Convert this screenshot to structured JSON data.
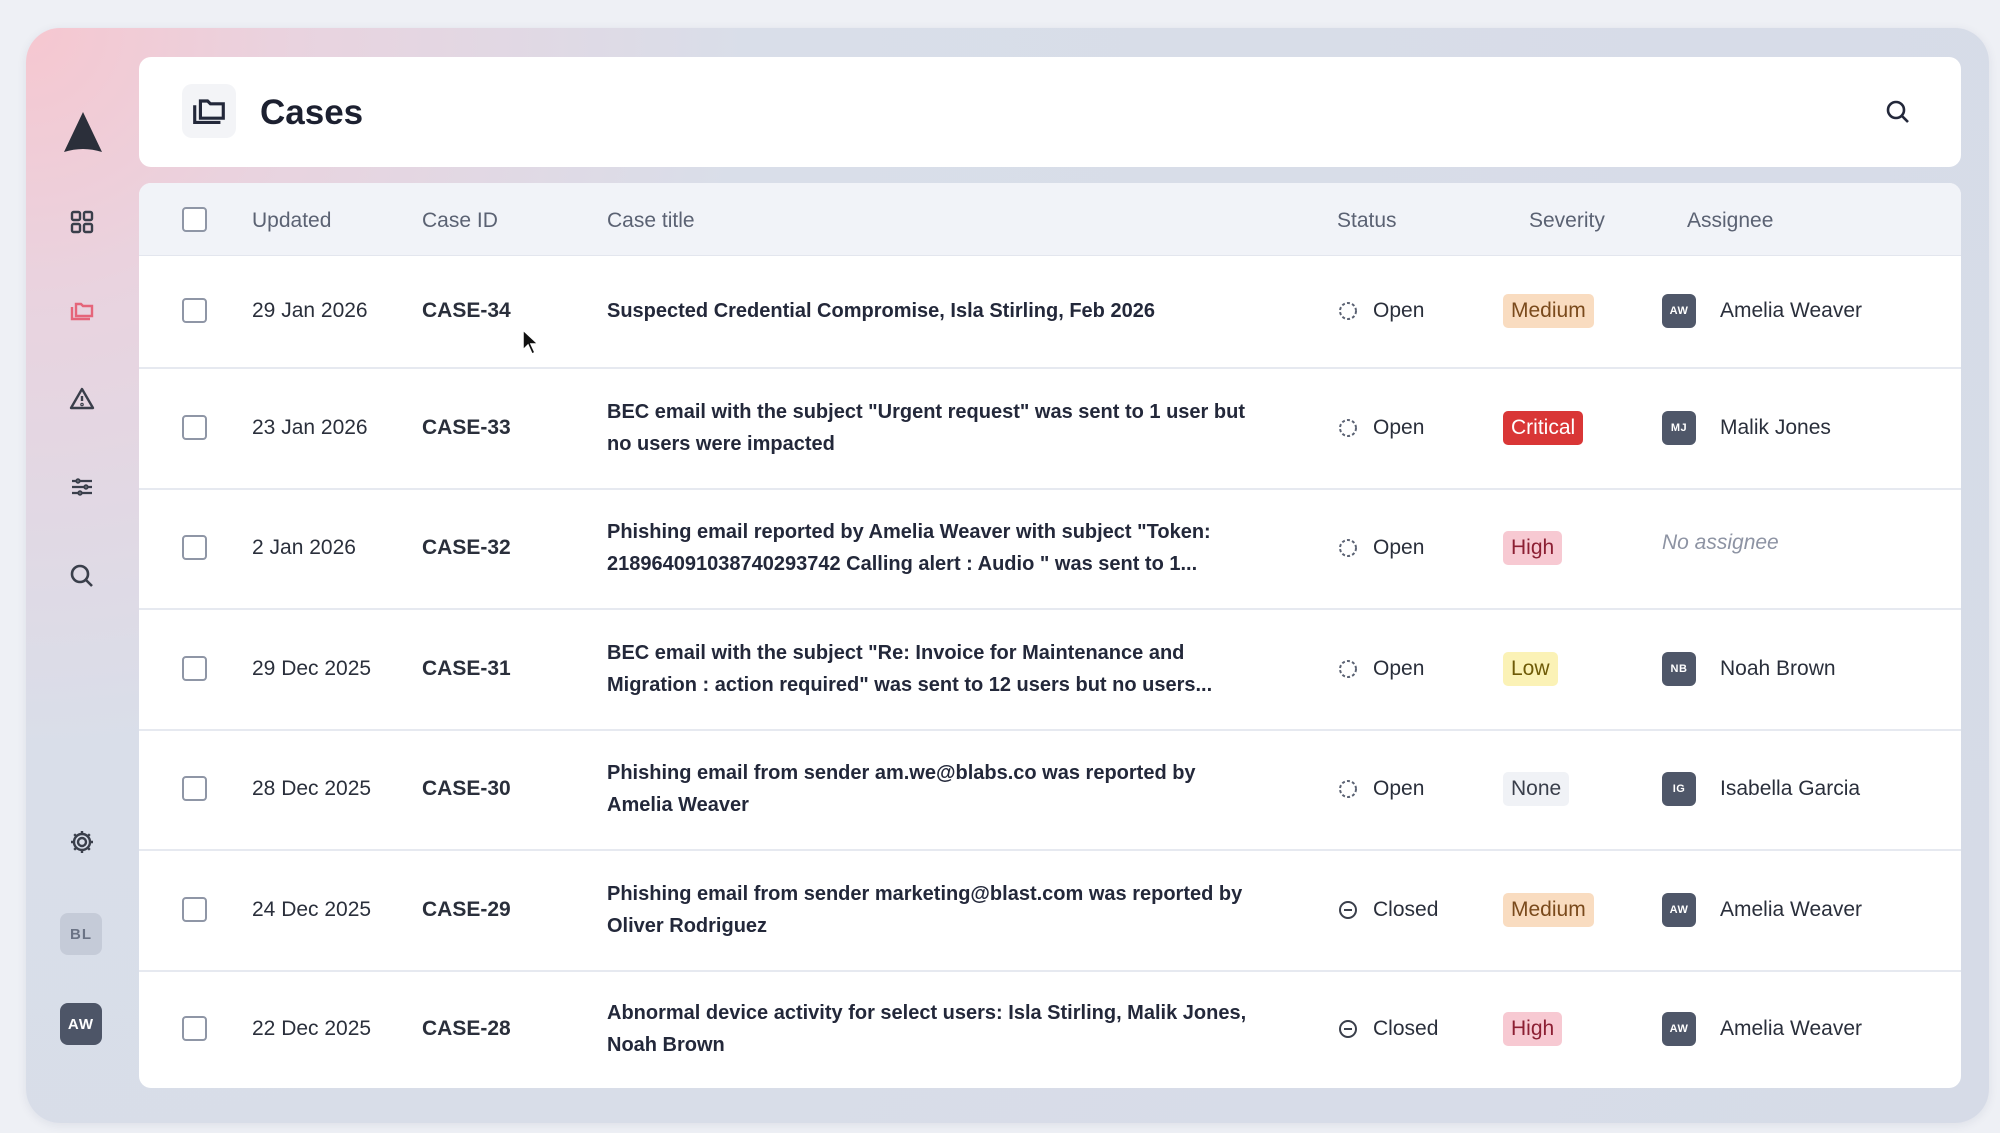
{
  "header": {
    "title": "Cases"
  },
  "sidebar": {
    "items": [
      {
        "name": "dashboard"
      },
      {
        "name": "cases"
      },
      {
        "name": "alerts"
      },
      {
        "name": "filters"
      },
      {
        "name": "search"
      },
      {
        "name": "settings"
      }
    ],
    "avatars": [
      "BL",
      "AW"
    ]
  },
  "colors": {
    "accent": "#e5657a",
    "medium_bg": "#f9dcc0",
    "medium_fg": "#7a4a1c",
    "critical_bg": "#d93636",
    "critical_fg": "#ffffff",
    "high_bg": "#f7c9d2",
    "high_fg": "#8c1f33",
    "low_bg": "#fbf2b6",
    "low_fg": "#6f5b07",
    "none_bg": "#f0f2f6",
    "none_fg": "#3a3f4b"
  },
  "table": {
    "columns": [
      "Updated",
      "Case ID",
      "Case title",
      "Status",
      "Severity",
      "Assignee"
    ],
    "rows": [
      {
        "updated": "29 Jan 2026",
        "id": "CASE-34",
        "title": "Suspected Credential Compromise, Isla Stirling, Feb 2026",
        "status": "Open",
        "severity": "Medium",
        "initials": "AW",
        "assignee": "Amelia Weaver"
      },
      {
        "updated": "23 Jan 2026",
        "id": "CASE-33",
        "title": "BEC email with the subject \"Urgent request\" was sent to 1 user but no users were impacted",
        "status": "Open",
        "severity": "Critical",
        "initials": "MJ",
        "assignee": "Malik Jones"
      },
      {
        "updated": "2 Jan 2026",
        "id": "CASE-32",
        "title": "Phishing email reported by Amelia Weaver with subject \"Token: 218964091038740293742 Calling alert : Audio \" was sent to 1...",
        "status": "Open",
        "severity": "High",
        "initials": "",
        "assignee": "No assignee"
      },
      {
        "updated": "29 Dec 2025",
        "id": "CASE-31",
        "title": "BEC email with the subject \"Re: Invoice for Maintenance and Migration : action required\" was sent to 12 users but no users...",
        "status": "Open",
        "severity": "Low",
        "initials": "NB",
        "assignee": "Noah Brown"
      },
      {
        "updated": "28 Dec 2025",
        "id": "CASE-30",
        "title": "Phishing email from sender am.we@blabs.co was reported by Amelia Weaver",
        "status": "Open",
        "severity": "None",
        "initials": "IG",
        "assignee": "Isabella Garcia"
      },
      {
        "updated": "24 Dec 2025",
        "id": "CASE-29",
        "title": "Phishing email from sender marketing@blast.com was reported by Oliver Rodriguez",
        "status": "Closed",
        "severity": "Medium",
        "initials": "AW",
        "assignee": "Amelia Weaver"
      },
      {
        "updated": "22 Dec 2025",
        "id": "CASE-28",
        "title": "Abnormal device activity for select users: Isla Stirling, Malik Jones, Noah Brown",
        "status": "Closed",
        "severity": "High",
        "initials": "AW",
        "assignee": "Amelia Weaver"
      }
    ]
  }
}
